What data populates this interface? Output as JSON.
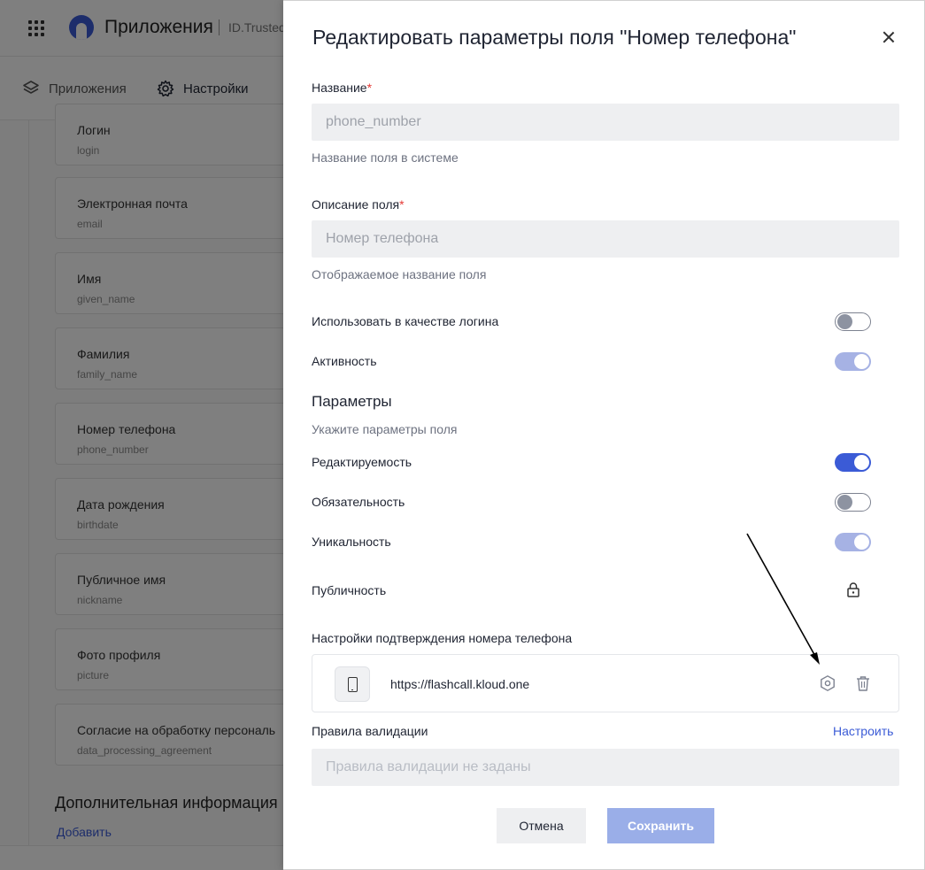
{
  "app": {
    "title": "Приложения",
    "org": "ID.Trusted"
  },
  "tabs": [
    {
      "label": "Приложения",
      "icon": "layers-icon"
    },
    {
      "label": "Настройки",
      "icon": "gear-icon",
      "active": true
    }
  ],
  "fields": [
    {
      "label": "Логин",
      "key": "login"
    },
    {
      "label": "Электронная почта",
      "key": "email"
    },
    {
      "label": "Имя",
      "key": "given_name"
    },
    {
      "label": "Фамилия",
      "key": "family_name"
    },
    {
      "label": "Номер телефона",
      "key": "phone_number"
    },
    {
      "label": "Дата рождения",
      "key": "birthdate"
    },
    {
      "label": "Публичное имя",
      "key": "nickname"
    },
    {
      "label": "Фото профиля",
      "key": "picture"
    },
    {
      "label": "Согласие на обработку персональ",
      "key": "data_processing_agreement"
    }
  ],
  "extra": {
    "title": "Дополнительная информация",
    "add_label": "Добавить"
  },
  "drawer": {
    "title": "Редактировать параметры поля \"Номер телефона\"",
    "name_label": "Название",
    "name_value": "phone_number",
    "name_hint": "Название поля в системе",
    "desc_label": "Описание поля",
    "desc_value": "Номер телефона",
    "desc_hint": "Отображаемое название поля",
    "use_as_login_label": "Использовать в качестве логина",
    "activity_label": "Активность",
    "params_title": "Параметры",
    "params_hint": "Укажите параметры поля",
    "editable_label": "Редактируемость",
    "required_label": "Обязательность",
    "unique_label": "Уникальность",
    "public_label": "Публичность",
    "phone_confirm_label": "Настройки подтверждения номера телефона",
    "phone_provider_url": "https://flashcall.kloud.one",
    "validation_label": "Правила валидации",
    "configure_label": "Настроить",
    "validation_placeholder": "Правила валидации не заданы",
    "cancel_label": "Отмена",
    "save_label": "Сохранить"
  },
  "toggles": {
    "use_as_login": false,
    "activity": true,
    "editable": true,
    "required": false,
    "unique": true
  },
  "colors": {
    "accent": "#3b5bd6",
    "disabled_accent": "#9aaee8",
    "required_mark": "#e53935"
  }
}
